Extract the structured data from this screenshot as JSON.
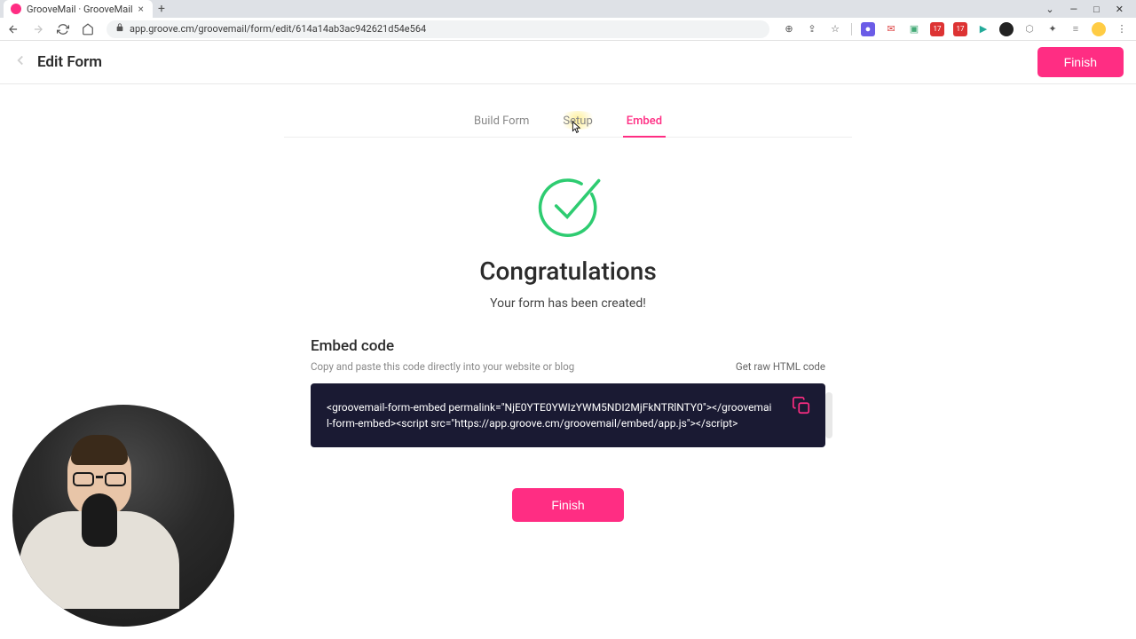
{
  "browser": {
    "tab_title": "GrooveMail · GrooveMail",
    "url": "app.groove.cm/groovemail/form/edit/614a14ab3ac942621d54e564",
    "window_controls": {
      "min": "—",
      "max": "□",
      "close": "✕"
    }
  },
  "header": {
    "title": "Edit Form",
    "finish_label": "Finish"
  },
  "tabs": {
    "build": "Build Form",
    "setup": "Setup",
    "embed": "Embed"
  },
  "main": {
    "congrats_title": "Congratulations",
    "congrats_sub": "Your form has been created!",
    "embed_title": "Embed code",
    "embed_hint": "Copy and paste this code directly into your website or blog",
    "raw_link": "Get raw HTML code",
    "code": "<groovemail-form-embed permalink=\"NjE0YTE0YWIzYWM5NDI2MjFkNTRlNTY0\"></groovemail-form-embed><script src=\"https://app.groove.cm/groovemail/embed/app.js\"></script>",
    "finish_label": "Finish"
  }
}
